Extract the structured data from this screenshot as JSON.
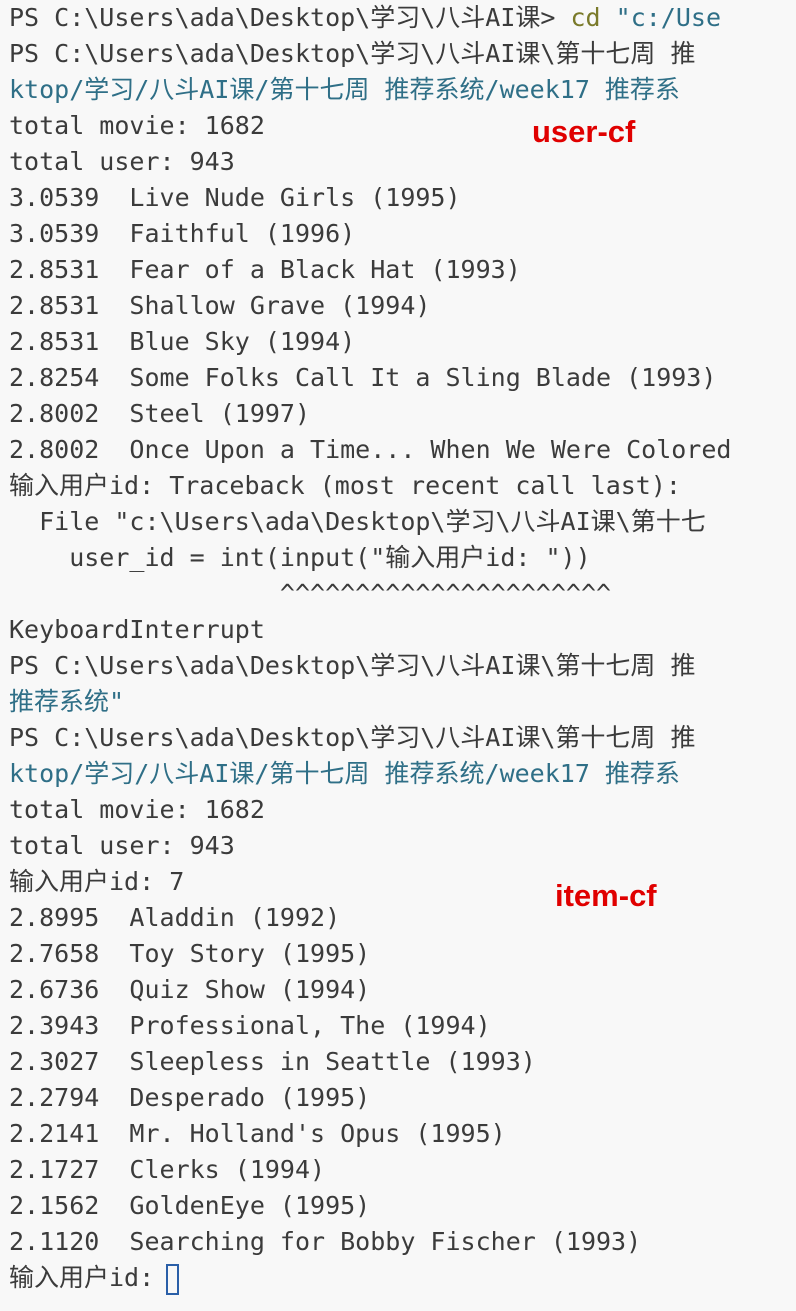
{
  "terminal": {
    "lines": [
      {
        "a": "PS C:\\Users\\ada\\Desktop\\学习\\八斗AI课> ",
        "b": "cd ",
        "c": "\"c:/Use",
        "t": "prompt-cd"
      },
      {
        "a": "PS C:\\Users\\ada\\Desktop\\学习\\八斗AI课\\第十七周 推",
        "t": "prompt"
      },
      {
        "a": "ktop/学习/八斗AI课/第十七周 推荐系统/week17 推荐系",
        "t": "path"
      },
      {
        "a": "total movie: 1682",
        "t": "out"
      },
      {
        "a": "total user: 943",
        "t": "out"
      },
      {
        "a": "3.0539  Live Nude Girls (1995)",
        "t": "out"
      },
      {
        "a": "3.0539  Faithful (1996)",
        "t": "out"
      },
      {
        "a": "2.8531  Fear of a Black Hat (1993)",
        "t": "out"
      },
      {
        "a": "2.8531  Shallow Grave (1994)",
        "t": "out"
      },
      {
        "a": "2.8531  Blue Sky (1994)",
        "t": "out"
      },
      {
        "a": "2.8254  Some Folks Call It a Sling Blade (1993)",
        "t": "out"
      },
      {
        "a": "2.8002  Steel (1997)",
        "t": "out"
      },
      {
        "a": "2.8002  Once Upon a Time... When We Were Colored",
        "t": "out"
      },
      {
        "a": "输入用户id: Traceback (most recent call last):",
        "t": "out"
      },
      {
        "a": "  File \"c:\\Users\\ada\\Desktop\\学习\\八斗AI课\\第十七",
        "t": "out"
      },
      {
        "a": "    user_id = int(input(\"输入用户id: \"))",
        "t": "out"
      },
      {
        "a": "                  ^^^^^^^^^^^^^^^^^^^^^^",
        "t": "out"
      },
      {
        "a": "KeyboardInterrupt",
        "t": "out"
      },
      {
        "a": "PS C:\\Users\\ada\\Desktop\\学习\\八斗AI课\\第十七周 推",
        "t": "prompt"
      },
      {
        "a": "推荐系统\"",
        "t": "path"
      },
      {
        "a": "PS C:\\Users\\ada\\Desktop\\学习\\八斗AI课\\第十七周 推",
        "t": "prompt"
      },
      {
        "a": "ktop/学习/八斗AI课/第十七周 推荐系统/week17 推荐系",
        "t": "path"
      },
      {
        "a": "total movie: 1682",
        "t": "out"
      },
      {
        "a": "total user: 943",
        "t": "out"
      },
      {
        "a": "输入用户id: 7",
        "t": "out"
      },
      {
        "a": "2.8995  Aladdin (1992)",
        "t": "out"
      },
      {
        "a": "2.7658  Toy Story (1995)",
        "t": "out"
      },
      {
        "a": "2.6736  Quiz Show (1994)",
        "t": "out"
      },
      {
        "a": "2.3943  Professional, The (1994)",
        "t": "out"
      },
      {
        "a": "2.3027  Sleepless in Seattle (1993)",
        "t": "out"
      },
      {
        "a": "2.2794  Desperado (1995)",
        "t": "out"
      },
      {
        "a": "2.2141  Mr. Holland's Opus (1995)",
        "t": "out"
      },
      {
        "a": "2.1727  Clerks (1994)",
        "t": "out"
      },
      {
        "a": "2.1562  GoldenEye (1995)",
        "t": "out"
      },
      {
        "a": "2.1120  Searching for Bobby Fischer (1993)",
        "t": "out"
      },
      {
        "a": "输入用户id:",
        "t": "input"
      }
    ]
  },
  "annotations": {
    "user_cf": "user-cf",
    "item_cf": "item-cf"
  },
  "colors": {
    "text": "#3b3b3b",
    "command": "#7a7a2a",
    "string": "#2f6f87",
    "annotation": "#e00000",
    "cursor": "#2a5fa8"
  }
}
